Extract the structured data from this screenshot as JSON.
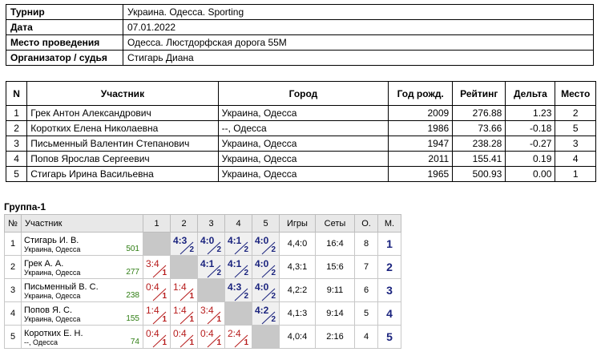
{
  "info": [
    {
      "label": "Турнир",
      "value": "Украина. Одесса. Sporting"
    },
    {
      "label": "Дата",
      "value": "07.01.2022"
    },
    {
      "label": "Место проведения",
      "value": "Одесса. Люстдорфская дорога 55М"
    },
    {
      "label": "Организатор / судья",
      "value": "Стигарь Диана"
    }
  ],
  "participants": {
    "headers": [
      "N",
      "Участник",
      "Город",
      "Год рожд.",
      "Рейтинг",
      "Дельта",
      "Место"
    ],
    "rows": [
      {
        "n": "1",
        "name": "Грек Антон Александрович",
        "city": "Украина, Одесса",
        "year": "2009",
        "rating": "276.88",
        "delta": "1.23",
        "place": "2"
      },
      {
        "n": "2",
        "name": "Коротких Елена Николаевна",
        "city": "--, Одесса",
        "year": "1986",
        "rating": "73.66",
        "delta": "-0.18",
        "place": "5"
      },
      {
        "n": "3",
        "name": "Письменный Валентин Степанович",
        "city": "Украина, Одесса",
        "year": "1947",
        "rating": "238.28",
        "delta": "-0.27",
        "place": "3"
      },
      {
        "n": "4",
        "name": "Попов Ярослав Сергеевич",
        "city": "Украина, Одесса",
        "year": "2011",
        "rating": "155.41",
        "delta": "0.19",
        "place": "4"
      },
      {
        "n": "5",
        "name": "Стигарь Ирина Васильевна",
        "city": "Украина, Одесса",
        "year": "1965",
        "rating": "500.93",
        "delta": "0.00",
        "place": "1"
      }
    ]
  },
  "group": {
    "title": "Группа-1",
    "headers": {
      "num": "№",
      "player": "Участник",
      "cols": [
        "1",
        "2",
        "3",
        "4",
        "5"
      ],
      "games": "Игры",
      "sets": "Сеты",
      "points": "О.",
      "place": "М."
    },
    "rows": [
      {
        "num": "1",
        "name": "Стигарь И. В.",
        "city": "Украина, Одесса",
        "rating": "501",
        "cells": [
          null,
          {
            "s": "4:3",
            "p": "2",
            "w": true
          },
          {
            "s": "4:0",
            "p": "2",
            "w": true
          },
          {
            "s": "4:1",
            "p": "2",
            "w": true
          },
          {
            "s": "4:0",
            "p": "2",
            "w": true
          }
        ],
        "games": "4,4:0",
        "sets": "16:4",
        "points": "8",
        "place": "1"
      },
      {
        "num": "2",
        "name": "Грек А. А.",
        "city": "Украина, Одесса",
        "rating": "277",
        "cells": [
          {
            "s": "3:4",
            "p": "1",
            "w": false
          },
          null,
          {
            "s": "4:1",
            "p": "2",
            "w": true
          },
          {
            "s": "4:1",
            "p": "2",
            "w": true
          },
          {
            "s": "4:0",
            "p": "2",
            "w": true
          }
        ],
        "games": "4,3:1",
        "sets": "15:6",
        "points": "7",
        "place": "2"
      },
      {
        "num": "3",
        "name": "Письменный В. С.",
        "city": "Украина, Одесса",
        "rating": "238",
        "cells": [
          {
            "s": "0:4",
            "p": "1",
            "w": false
          },
          {
            "s": "1:4",
            "p": "1",
            "w": false
          },
          null,
          {
            "s": "4:3",
            "p": "2",
            "w": true
          },
          {
            "s": "4:0",
            "p": "2",
            "w": true
          }
        ],
        "games": "4,2:2",
        "sets": "9:11",
        "points": "6",
        "place": "3"
      },
      {
        "num": "4",
        "name": "Попов Я. С.",
        "city": "Украина, Одесса",
        "rating": "155",
        "cells": [
          {
            "s": "1:4",
            "p": "1",
            "w": false
          },
          {
            "s": "1:4",
            "p": "1",
            "w": false
          },
          {
            "s": "3:4",
            "p": "1",
            "w": false
          },
          null,
          {
            "s": "4:2",
            "p": "2",
            "w": true
          }
        ],
        "games": "4,1:3",
        "sets": "9:14",
        "points": "5",
        "place": "4"
      },
      {
        "num": "5",
        "name": "Коротких Е. Н.",
        "city": "--, Одесса",
        "rating": "74",
        "cells": [
          {
            "s": "0:4",
            "p": "1",
            "w": false
          },
          {
            "s": "0:4",
            "p": "1",
            "w": false
          },
          {
            "s": "0:4",
            "p": "1",
            "w": false
          },
          {
            "s": "2:4",
            "p": "1",
            "w": false
          },
          null
        ],
        "games": "4,0:4",
        "sets": "2:16",
        "points": "4",
        "place": "5"
      }
    ]
  }
}
